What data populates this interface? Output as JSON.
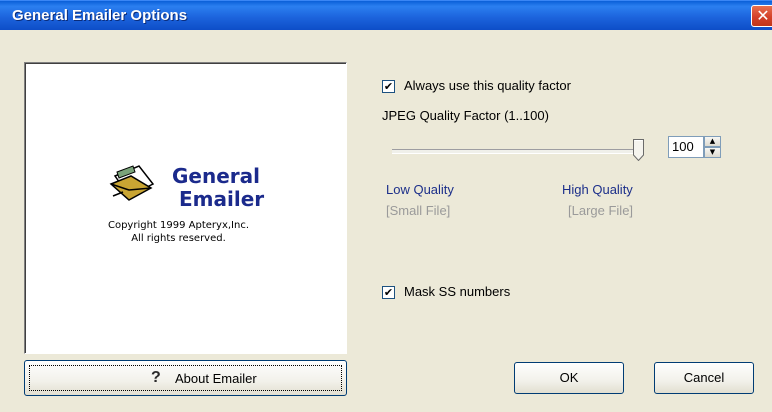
{
  "window": {
    "title": "General Emailer Options",
    "close_glyph": "✕"
  },
  "logo": {
    "line1": "General",
    "line2": "Emailer",
    "copyright1": "Copyright 1999 Apteryx,Inc.",
    "copyright2": "All rights reserved.",
    "icon": "envelope-icon"
  },
  "buttons": {
    "about_label": "About Emailer",
    "about_icon": "help-question-icon",
    "ok_label": "OK",
    "cancel_label": "Cancel"
  },
  "options": {
    "always_quality_label": "Always use this quality factor",
    "always_quality_checked": true,
    "jpeg_label": "JPEG Quality Factor  (1..100)",
    "quality_value": "100",
    "quality_level": 1.0,
    "low_quality": "Low Quality",
    "low_quality_sub": "[Small File]",
    "high_quality": "High Quality",
    "high_quality_sub": "[Large File]",
    "mask_ss_label": "Mask SS numbers",
    "mask_ss_checked": true,
    "check_glyph": "✔"
  },
  "colors": {
    "titlebar": "#0c4cc6",
    "close": "#d4412a",
    "face": "#ece9d8",
    "link_blue": "#1c2f8a"
  }
}
